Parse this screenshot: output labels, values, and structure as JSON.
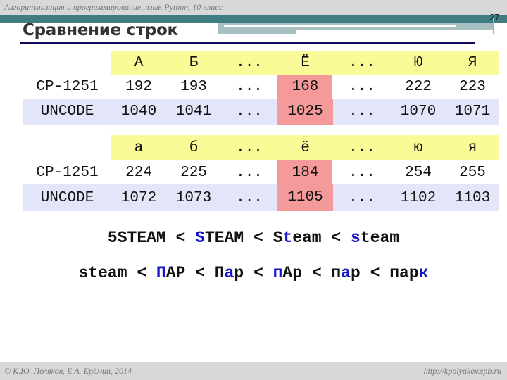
{
  "header": {
    "course": "Алгоритмизация и программирование, язык Python, 10 класс",
    "slide_number": "27",
    "title": "Сравнение строк"
  },
  "tables": [
    {
      "columns": [
        "А",
        "Б",
        "...",
        "Ё",
        "...",
        "Ю",
        "Я"
      ],
      "rows": [
        {
          "label": "CP-1251",
          "values": [
            "192",
            "193",
            "...",
            "168",
            "...",
            "222",
            "223"
          ]
        },
        {
          "label": "UNCODE",
          "values": [
            "1040",
            "1041",
            "...",
            "1025",
            "...",
            "1070",
            "1071"
          ]
        }
      ]
    },
    {
      "columns": [
        "а",
        "б",
        "...",
        "ё",
        "...",
        "ю",
        "я"
      ],
      "rows": [
        {
          "label": "CP-1251",
          "values": [
            "224",
            "225",
            "...",
            "184",
            "...",
            "254",
            "255"
          ]
        },
        {
          "label": "UNCODE",
          "values": [
            "1072",
            "1073",
            "...",
            "1105",
            "...",
            "1102",
            "1103"
          ]
        }
      ]
    }
  ],
  "comparisons": {
    "line1": [
      {
        "t": "5STEAM < "
      },
      {
        "t": "S",
        "hl": true
      },
      {
        "t": "TEAM < S"
      },
      {
        "t": "t",
        "hl": true
      },
      {
        "t": "eam < "
      },
      {
        "t": "s",
        "hl": true
      },
      {
        "t": "team"
      }
    ],
    "line2": [
      {
        "t": "steam < "
      },
      {
        "t": "П",
        "hl": true
      },
      {
        "t": "АР < П"
      },
      {
        "t": "а",
        "hl": true
      },
      {
        "t": "р < "
      },
      {
        "t": "п",
        "hl": true
      },
      {
        "t": "Ар < п"
      },
      {
        "t": "а",
        "hl": true
      },
      {
        "t": "р < пар"
      },
      {
        "t": "к",
        "hl": true
      }
    ]
  },
  "colors": {
    "highlight": "#1515c8",
    "header_row": "#fafa96",
    "unicode_row": "#e3e5f8",
    "highlight_column": "#f59a9a"
  },
  "footer": {
    "copyright": "© К.Ю. Поляков, Е.А. Ерёмин, 2014",
    "url": "http://kpolyakov.spb.ru"
  }
}
